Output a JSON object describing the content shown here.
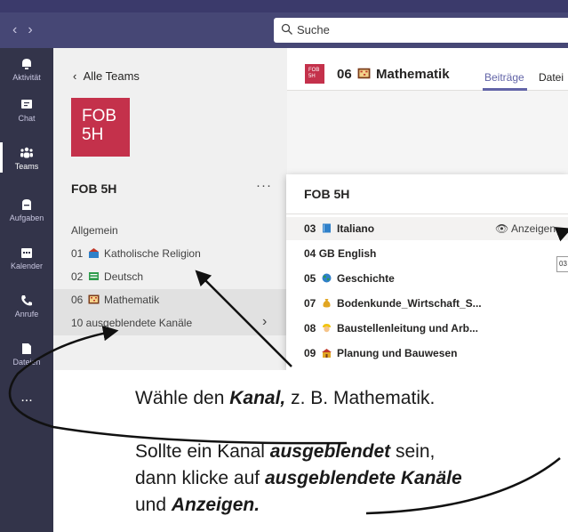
{
  "topbar": {
    "search_placeholder": "Suche"
  },
  "rail": [
    {
      "label": "Aktivität",
      "icon": "bell-icon"
    },
    {
      "label": "Chat",
      "icon": "chat-icon"
    },
    {
      "label": "Teams",
      "icon": "teams-icon",
      "active": true
    },
    {
      "label": "Aufgaben",
      "icon": "assignments-icon"
    },
    {
      "label": "Kalender",
      "icon": "calendar-icon"
    },
    {
      "label": "Anrufe",
      "icon": "phone-icon"
    },
    {
      "label": "Dateien",
      "icon": "files-icon"
    },
    {
      "label": "...",
      "icon": "more-icon"
    }
  ],
  "panel": {
    "back_label": "Alle Teams",
    "logo_line1": "FOB",
    "logo_line2": "5H",
    "team_name": "FOB 5H",
    "more": "···",
    "channels": [
      {
        "prefix": "",
        "name": "Allgemein"
      },
      {
        "prefix": "01",
        "name": "Katholische Religion"
      },
      {
        "prefix": "02",
        "name": "Deutsch"
      },
      {
        "prefix": "06",
        "name": "Mathematik"
      },
      {
        "prefix": "",
        "name": "10 ausgeblendete Kanäle"
      }
    ]
  },
  "main": {
    "logo_line1": "FOB",
    "logo_line2": "5H",
    "title_prefix": "06",
    "title": "Mathematik",
    "tab_posts": "Beiträge",
    "tab_files": "Datei"
  },
  "popup": {
    "title": "FOB 5H",
    "show_label": "Anzeigen",
    "tooltip": "03",
    "items": [
      {
        "prefix": "03",
        "name": "Italiano"
      },
      {
        "prefix": "04",
        "name": "GB English"
      },
      {
        "prefix": "05",
        "name": "Geschichte"
      },
      {
        "prefix": "07",
        "name": "Bodenkunde_Wirtschaft_S..."
      },
      {
        "prefix": "08",
        "name": "Baustellenleitung und Arb..."
      },
      {
        "prefix": "09",
        "name": "Planung und Bauwesen"
      }
    ]
  },
  "annotation": {
    "line1_pre": "Wähle den ",
    "line1_bold": "Kanal,",
    "line1_post": " z. B. Mathematik.",
    "line2_pre": "Sollte ein Kanal ",
    "line2_bold": "ausgeblendet",
    "line2_post": " sein,",
    "line3_pre": "dann klicke auf ",
    "line3_bold": "ausgeblendete Kanäle",
    "line4_pre": "und ",
    "line4_bold": "Anzeigen."
  },
  "colors": {
    "accent": "#6264a7",
    "team": "#c4314b",
    "rail": "#33344a",
    "topbar": "#464775"
  }
}
